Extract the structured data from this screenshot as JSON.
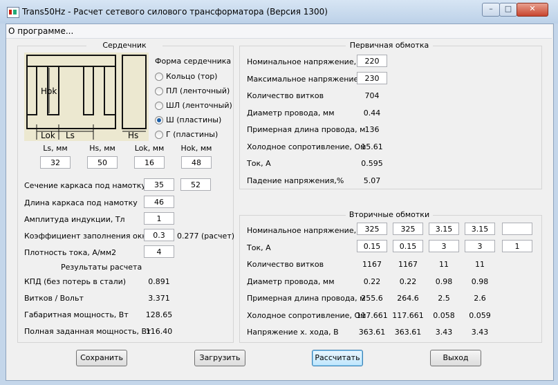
{
  "window": {
    "title": "Trans50Hz - Расчет сетевого силового трансформатора (Версия 1300)",
    "min": "–",
    "max": "□",
    "close": "✕"
  },
  "menu": {
    "about": "О программе..."
  },
  "core": {
    "title": "Сердечник",
    "diagram": {
      "hok": "Hok",
      "lok": "Lok",
      "ls": "Ls",
      "hs": "Hs"
    },
    "shape_title": "Форма сердечника",
    "shapes": [
      {
        "label": "Кольцо  (тор)",
        "selected": false
      },
      {
        "label": "ПЛ  (ленточный)",
        "selected": false
      },
      {
        "label": "ШЛ  (ленточный)",
        "selected": false
      },
      {
        "label": "Ш  (пластины)",
        "selected": true
      },
      {
        "label": "Г (пластины)",
        "selected": false
      }
    ],
    "dims": [
      {
        "label": "Ls, мм",
        "value": "32"
      },
      {
        "label": "Hs, мм",
        "value": "50"
      },
      {
        "label": "Lok, мм",
        "value": "16"
      },
      {
        "label": "Hok, мм",
        "value": "48"
      }
    ],
    "params": {
      "section_label": "Сечение каркаса под намотку",
      "section_a": "35",
      "section_b": "52",
      "length_label": "Длина каркаса под намотку",
      "length": "46",
      "induction_label": "Амплитуда индукции, Тл",
      "induction": "1",
      "fill_label": "Коэффициент заполнения окна",
      "fill": "0.3",
      "fill_calc": "0.277 (расчет)",
      "density_label": "Плотность тока, А/мм2",
      "density": "4"
    },
    "results_title": "Результаты расчета",
    "results": [
      {
        "label": "КПД (без потерь в стали)",
        "value": "0.891"
      },
      {
        "label": "Витков / Вольт",
        "value": "3.371"
      },
      {
        "label": "Габаритная мощность, Вт",
        "value": "128.65"
      },
      {
        "label": "Полная заданная мощность, Вт",
        "value": "116.40"
      }
    ]
  },
  "primary": {
    "title": "Первичная обмотка",
    "rows": [
      {
        "label": "Номинальное напряжение, В",
        "value": "220",
        "input": true
      },
      {
        "label": "Максимальное напряжение, В",
        "value": "230",
        "input": true
      },
      {
        "label": "Количество витков",
        "value": "704",
        "input": false
      },
      {
        "label": "Диаметр провода, мм",
        "value": "0.44",
        "input": false
      },
      {
        "label": "Примерная длина провода, м",
        "value": "136",
        "input": false
      },
      {
        "label": "Холодное сопротивление, Ом",
        "value": "15.61",
        "input": false
      },
      {
        "label": "Ток, А",
        "value": "0.595",
        "input": false
      },
      {
        "label": "Падение напряжения,%",
        "value": "5.07",
        "input": false
      }
    ]
  },
  "secondary": {
    "title": "Вторичные обмотки",
    "rows": [
      {
        "label": "Номинальное напряжение, В",
        "input": true,
        "values": [
          "325",
          "325",
          "3.15",
          "3.15",
          ""
        ]
      },
      {
        "label": "Ток, А",
        "input": true,
        "values": [
          "0.15",
          "0.15",
          "3",
          "3",
          "1"
        ]
      },
      {
        "label": "Количество витков",
        "input": false,
        "values": [
          "1167",
          "1167",
          "11",
          "11"
        ]
      },
      {
        "label": "Диаметр провода, мм",
        "input": false,
        "values": [
          "0.22",
          "0.22",
          "0.98",
          "0.98"
        ]
      },
      {
        "label": "Примерная длина провода, м",
        "input": false,
        "values": [
          "255.6",
          "264.6",
          "2.5",
          "2.6"
        ]
      },
      {
        "label": "Холодное сопротивление, Ом",
        "input": false,
        "values": [
          "117.661",
          "117.661",
          "0.058",
          "0.059"
        ]
      },
      {
        "label": "Напряжение х. хода, В",
        "input": false,
        "values": [
          "363.61",
          "363.61",
          "3.43",
          "3.43"
        ]
      }
    ]
  },
  "buttons": {
    "save": "Сохранить",
    "load": "Загрузить",
    "calc": "Рассчитать",
    "exit": "Выход"
  }
}
